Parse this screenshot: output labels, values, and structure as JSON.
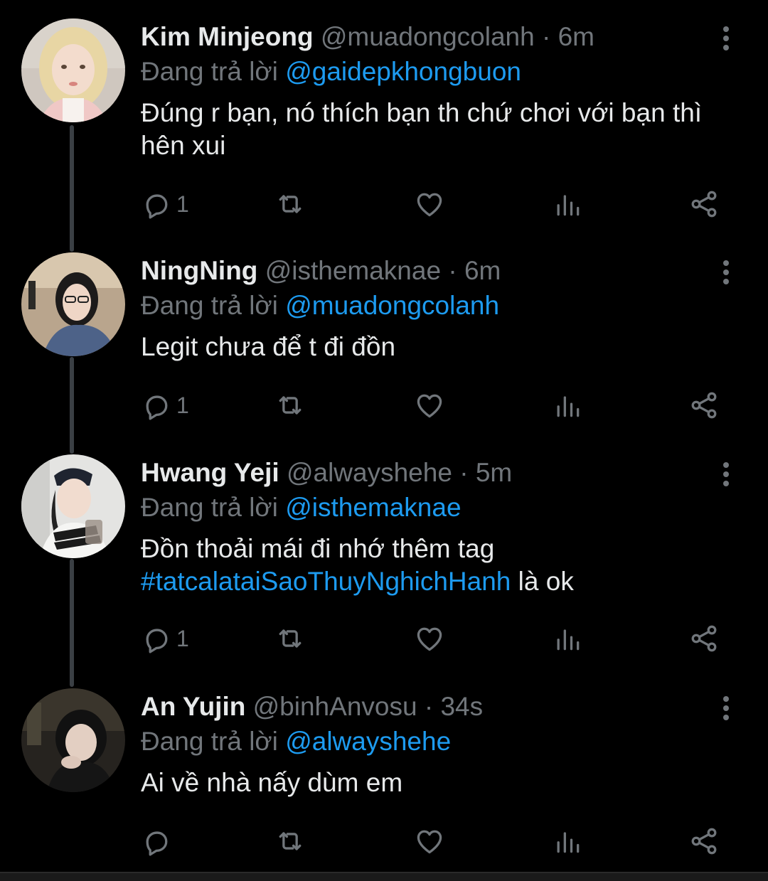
{
  "replying_label": "Đang trả lời",
  "tweets": [
    {
      "name": "Kim Minjeong",
      "handle": "@muadongcolanh",
      "dot": "·",
      "time": "6m",
      "replying_to": "@gaidepkhongbuon",
      "text_line1": "Đúng r bạn, nó thích bạn th chứ chơi với bạn thì",
      "text_line2": "hên xui",
      "reply_count": "1"
    },
    {
      "name": "NingNing",
      "handle": "@isthemaknae",
      "dot": "·",
      "time": "6m",
      "replying_to": "@muadongcolanh",
      "text_line1": "Legit chưa để t đi đồn",
      "reply_count": "1"
    },
    {
      "name": "Hwang Yeji",
      "handle": "@alwayshehe",
      "dot": "·",
      "time": "5m",
      "replying_to": "@isthemaknae",
      "text_line1": "Đồn thoải mái đi nhớ thêm tag",
      "hashtag": "#tatcalataiSaoThuyNghichHanh",
      "text_tail": " là ok",
      "reply_count": "1"
    },
    {
      "name": "An Yujin",
      "handle": "@binhAnvosu",
      "dot": "·",
      "time": "34s",
      "replying_to": "@alwayshehe",
      "text_line1": "Ai về nhà nấy dùm em",
      "reply_count": ""
    }
  ],
  "icons": {
    "reply": "reply-icon",
    "retweet": "retweet-icon",
    "like": "heart-icon",
    "stats": "bar-chart-icon",
    "share": "share-icon",
    "more": "more-vertical-icon"
  },
  "colors": {
    "background": "#000000",
    "text": "#e7e9ea",
    "muted": "#71767b",
    "link": "#1d9bf0",
    "thread_line": "#3a3f44"
  }
}
